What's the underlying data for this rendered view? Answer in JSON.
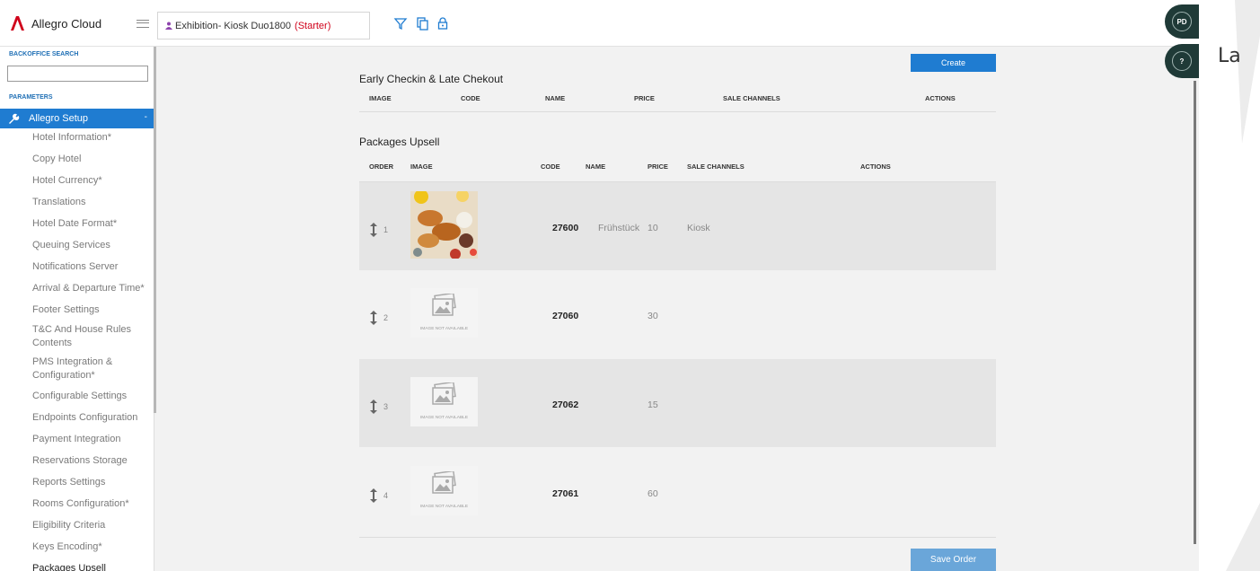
{
  "app": {
    "name": "Allegro Cloud",
    "brand_color": "#d0021b",
    "accent_color": "#1f7cd1"
  },
  "topbar": {
    "hotel_name": "Exhibition- Kiosk Duo1800",
    "hotel_tier": "(Starter)",
    "icons": [
      "filter-icon",
      "copy-icon",
      "lock-icon"
    ]
  },
  "user": {
    "initials": "PD",
    "help": "?",
    "side_text": "La"
  },
  "sidebar": {
    "search_caption": "BACKOFFICE SEARCH",
    "search_value": "",
    "params_caption": "PARAMETERS",
    "active_group": "Allegro Setup",
    "active_group_toggle": "-",
    "items": [
      "Hotel Information*",
      "Copy Hotel",
      "Hotel Currency*",
      "Translations",
      "Hotel Date Format*",
      "Queuing Services",
      "Notifications Server",
      "Arrival & Departure Time*",
      "Footer Settings",
      "T&C And House Rules Contents",
      "PMS Integration & Configuration*",
      "Configurable Settings",
      "Endpoints Configuration",
      "Payment Integration",
      "Reservations Storage",
      "Reports Settings",
      "Rooms Configuration*",
      "Eligibility Criteria",
      "Keys Encoding*",
      "Packages Upsell"
    ]
  },
  "early": {
    "create_label": "Create",
    "title": "Early Checkin & Late Chekout",
    "columns": [
      "IMAGE",
      "CODE",
      "NAME",
      "PRICE",
      "SALE CHANNELS",
      "ACTIONS"
    ]
  },
  "upsell": {
    "title": "Packages Upsell",
    "columns": [
      "ORDER",
      "IMAGE",
      "CODE",
      "NAME",
      "PRICE",
      "SALE CHANNELS",
      "ACTIONS"
    ],
    "no_image_text": "IMAGE NOT AVAILABLE",
    "rows": [
      {
        "order": "1",
        "code": "27600",
        "name": "Frühstück",
        "price": "10",
        "channels": "Kiosk",
        "has_image": true
      },
      {
        "order": "2",
        "code": "27060",
        "name": "",
        "price": "30",
        "channels": "",
        "has_image": false
      },
      {
        "order": "3",
        "code": "27062",
        "name": "",
        "price": "15",
        "channels": "",
        "has_image": false
      },
      {
        "order": "4",
        "code": "27061",
        "name": "",
        "price": "60",
        "channels": "",
        "has_image": false
      }
    ],
    "save_label": "Save Order"
  }
}
